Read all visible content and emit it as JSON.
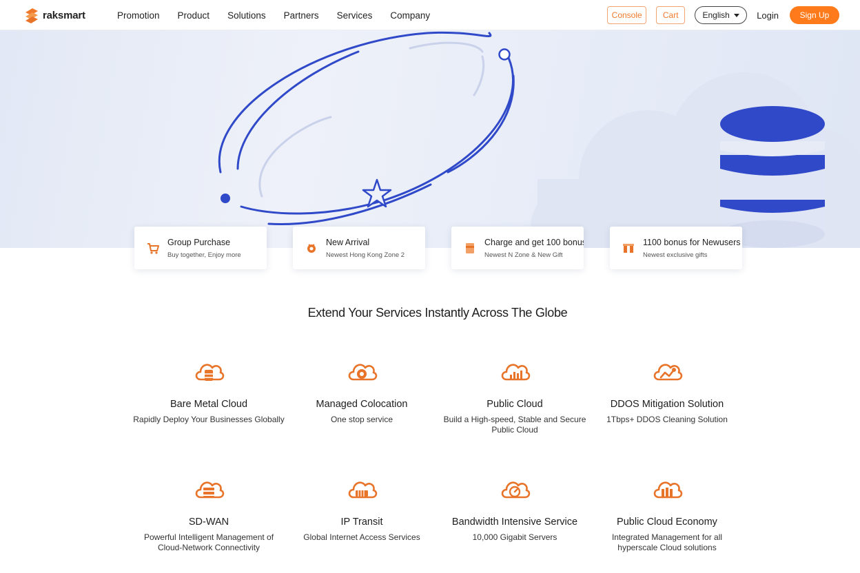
{
  "nav": {
    "brand": "raksmart",
    "links": [
      "Promotion",
      "Product",
      "Solutions",
      "Partners",
      "Services",
      "Company"
    ],
    "console_label": "Console",
    "cart_label": "Cart",
    "language": "English",
    "login_label": "Login",
    "signup_label": "Sign Up"
  },
  "promos": [
    {
      "title": "Group Purchase",
      "subtitle": "Buy together, Enjoy more",
      "icon": "cart-icon"
    },
    {
      "title": "New Arrival",
      "subtitle": "Newest Hong Kong Zone 2",
      "icon": "gift-icon"
    },
    {
      "title": "Charge and get 100 bonus",
      "subtitle": "Newest N Zone & New Gift",
      "icon": "card-icon"
    },
    {
      "title": "1100 bonus for Newusers",
      "subtitle": "Newest exclusive gifts",
      "icon": "bonus-icon"
    }
  ],
  "section": {
    "title": "Extend Your Services Instantly Across The Globe"
  },
  "services": [
    {
      "title": "Bare Metal Cloud",
      "desc": "Rapidly Deploy Your Businesses Globally",
      "icon": "bare-metal-cloud-icon"
    },
    {
      "title": "Managed Colocation",
      "desc": "One stop service",
      "icon": "managed-colocation-icon"
    },
    {
      "title": "Public Cloud",
      "desc": "Build a High-speed, Stable and Secure Public Cloud",
      "icon": "public-cloud-icon"
    },
    {
      "title": "DDOS Mitigation Solution",
      "desc": "1Tbps+ DDOS Cleaning Solution",
      "icon": "ddos-mitigation-icon"
    },
    {
      "title": "SD-WAN",
      "desc": "Powerful Intelligent Management of Cloud-Network Connectivity",
      "icon": "sd-wan-icon"
    },
    {
      "title": "IP Transit",
      "desc": "Global Internet Access Services",
      "icon": "ip-transit-icon"
    },
    {
      "title": "Bandwidth Intensive Service",
      "desc": "10,000 Gigabit Servers",
      "icon": "bandwidth-service-icon"
    },
    {
      "title": "Public Cloud Economy",
      "desc": "Integrated Management for all hyperscale Cloud solutions",
      "icon": "public-cloud-economy-icon"
    }
  ],
  "colors": {
    "accent": "#ff7a1a",
    "icon_orange": "#e8742a",
    "hero_blue": "#2f49c9"
  }
}
